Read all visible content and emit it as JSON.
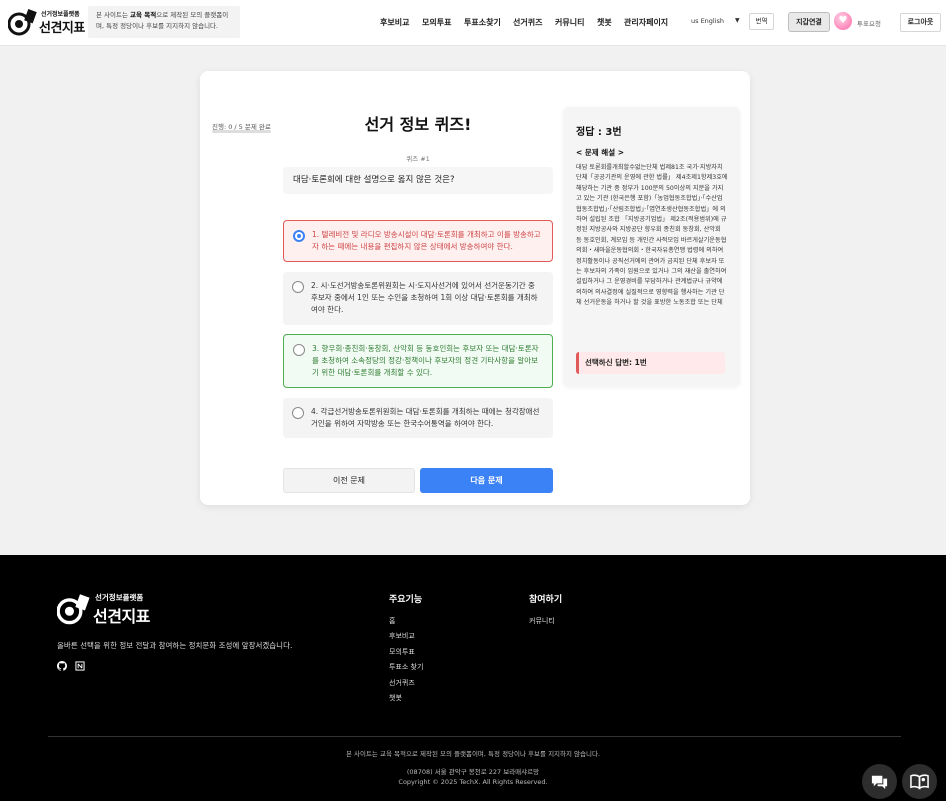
{
  "header": {
    "logo_small": "선거정보플랫폼",
    "logo_big": "선견지표",
    "notice_pre": "본 사이트는 ",
    "notice_bold": "교육 목적",
    "notice_post": "으로 제작된 모의 플랫폼이며, 특정 정당이나 후보를 지지하지 않습니다.",
    "nav": [
      "후보비교",
      "모의투표",
      "투표소찾기",
      "선거퀴즈",
      "커뮤니티",
      "챗봇",
      "관리자페이지"
    ],
    "language": "us English",
    "language_caret": "▼",
    "translate": "번역",
    "wallet": "지갑연결",
    "vote_request": "투표요청",
    "logout": "로그아웃"
  },
  "quiz": {
    "progress_label": "진행: 0 / 5 문제 완료",
    "progress_fraction": 0,
    "title": "선거 정보 퀴즈!",
    "number": "퀴즈 #1",
    "question": "대담·토론회에 대한 설명으로 옳지 않은 것은?",
    "options": [
      {
        "text": "1. 텔레비전 및 라디오 방송시설이 대담·토론회를 개최하고 이를 방송하고자 하는 때에는 내용을 편집하지 않은 상태에서 방송하여야 한다.",
        "state": "selected"
      },
      {
        "text": "2. 시·도선거방송토론위원회는 시·도지사선거에 있어서 선거운동기간 중 후보자 중에서 1인 또는 수인을 초청하여 1회 이상 대담·토론회를 개최하여야 한다.",
        "state": "plain"
      },
      {
        "text": "3. 향우회·종친회·동창회, 산악회 등 동호인회는 후보자 또는 대담·토론자를 초청하여 소속정당의 정강·정책이나 후보자의 정견 기타사항을 알아보기 위한 대담·토론회를 개최할 수 있다.",
        "state": "correct"
      },
      {
        "text": "4. 각급선거방송토론위원회는 대담·토론회를 개최하는 때에는 청각장애선거인을 위하여 자막방송 또는 한국수어통역을 하여야 한다.",
        "state": "plain"
      }
    ],
    "prev_label": "이전 문제",
    "next_label": "다음 문제"
  },
  "answer": {
    "title": "정답 : 3번",
    "explanation_heading": "< 문제 해설 >",
    "explanation": "대담 토론회를개최할수없는단체 법제81조 국가·지방자치단체「공공기관의 운영에 관한 법률」 제4조제1항제3호에 해당하는 기관 중 정부가 100분의 50이상의 지분을 가지고 있는 기관 (한국은행 포함)「농업협동조합법」·「수산업협동조합법」·「산림조합법」·「엽연초생산협동조합법」에 의하여 설립된 조합 「지방공기업법」 제2조(적용범위)에 규정된 지방공사와 지방공단 향우회 종친회 동창회, 산악회 등 동호인회, 계모임 등 개인간 사적모임 바르게살기운동협의회・새마을운동협의회・한국자유총연맹 법령에 의하여 정치활동이나 공직선거에의 관여가 금지된 단체 후보자 또는 후보자의 가족이 임원으로 있거나 그의 재산을 출연하여 설립하거나 그 운영경비를 부담하거나 관계법규나 규약에 의하여 의사결정에 실질적으로 영향력을 행사하는 기관 단체 선거운동을 하거나 할 것을 표방한 노동조합 또는 단체",
    "selected_answer": "선택하신 답변: 1번"
  },
  "footer": {
    "logo_small": "선거정보플랫폼",
    "logo_big": "선견지표",
    "tagline": "올바른 선택을 위한 정보 전달과 참여하는 정치문화 조성에 앞장서겠습니다.",
    "col1_title": "주요기능",
    "col1_links": [
      "홈",
      "후보비교",
      "모의투표",
      "투표소 찾기",
      "선거퀴즈",
      "챗봇"
    ],
    "col2_title": "참여하기",
    "col2_links": [
      "커뮤니티"
    ],
    "disclaimer": "본 사이트는 교육 목적으로 제작된 모의 플랫폼이며, 특정 정당이나 후보를 지지하지 않습니다.",
    "address": "(08708) 서울 관악구 봉천로 227 보라매샤르망",
    "copyright": "Copyright © 2025 TechX. All Rights Reserved."
  },
  "colors": {
    "accent": "#3b82f6",
    "selected_border": "#e05a5a",
    "correct_border": "#4caf50",
    "footer_bg": "#000000"
  },
  "icons": [
    "logo-eye-icon",
    "github-icon",
    "notion-icon",
    "chat-icon",
    "book-icon",
    "heart-icon"
  ]
}
